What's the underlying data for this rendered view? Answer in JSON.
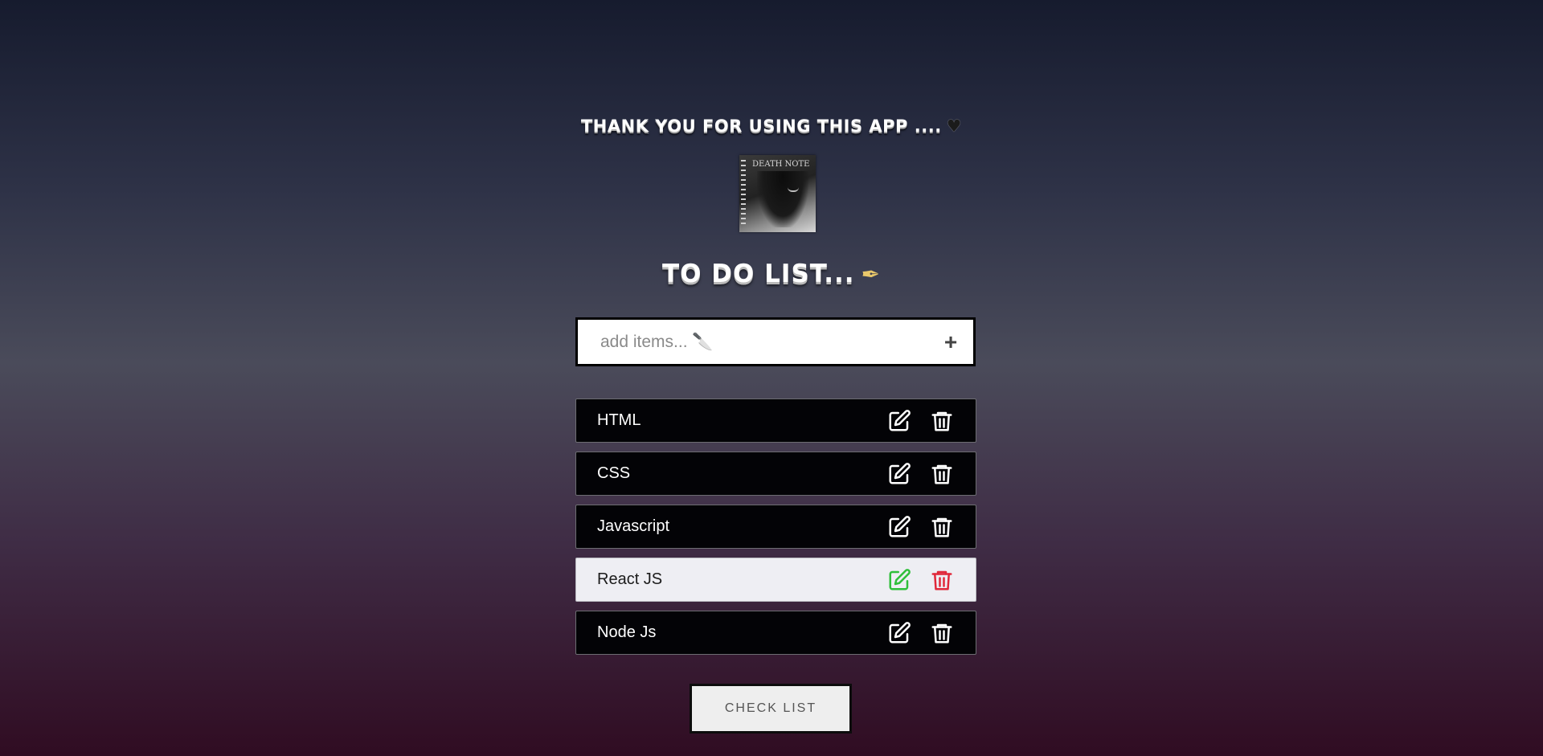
{
  "header": {
    "thanks_text": "THANK YOU FOR USING THIS APP ....",
    "thanks_icon": "heart-icon",
    "cover_text": "DEATH NOTE",
    "list_title": "TO DO LIST...",
    "title_icon": "pen-nib-icon"
  },
  "input": {
    "placeholder": "add items... 🔪",
    "value": "",
    "add_icon": "plus-icon"
  },
  "items": [
    {
      "label": "HTML",
      "state": "normal"
    },
    {
      "label": "CSS",
      "state": "normal"
    },
    {
      "label": "Javascript",
      "state": "normal"
    },
    {
      "label": "React JS",
      "state": "hover"
    },
    {
      "label": "Node Js",
      "state": "normal"
    }
  ],
  "item_actions": {
    "edit_icon": "edit-icon",
    "delete_icon": "trash-icon",
    "hover_edit_color": "#2fbf3a",
    "hover_delete_color": "#e0283a"
  },
  "footer": {
    "check_label": "CHECK LIST"
  },
  "colors": {
    "background_top": "#161b2e",
    "background_bottom": "#300c22",
    "item_bg": "#030306"
  }
}
